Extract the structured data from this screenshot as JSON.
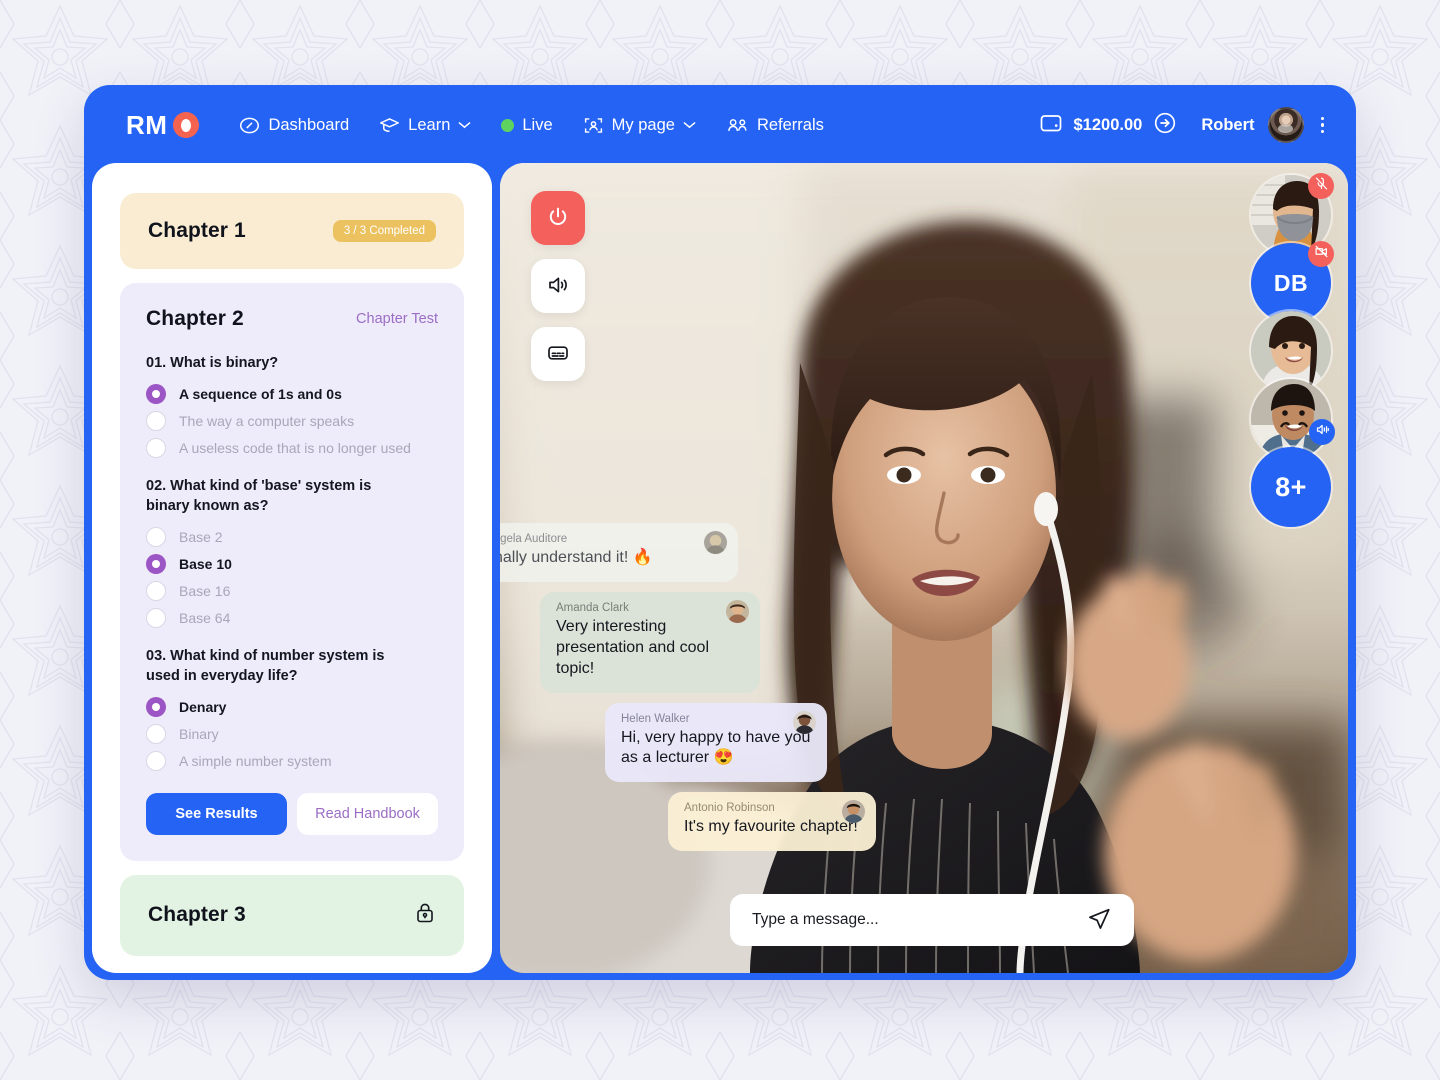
{
  "brand": {
    "text": "RM",
    "dot_icon": "record-dot-icon"
  },
  "nav": [
    {
      "label": "Dashboard",
      "icon": "dashboard-gauge-icon",
      "chevron": false
    },
    {
      "label": "Learn",
      "icon": "graduation-cap-icon",
      "chevron": true
    },
    {
      "label": "Live",
      "icon": "live-dot-icon",
      "chevron": false
    },
    {
      "label": "My page",
      "icon": "user-frame-icon",
      "chevron": true
    },
    {
      "label": "Referrals",
      "icon": "people-group-icon",
      "chevron": false
    }
  ],
  "header_right": {
    "wallet_icon": "wallet-icon",
    "wallet_amount": "$1200.00",
    "wallet_action_icon": "arrow-right-circle-icon",
    "user_name": "Robert",
    "avatar_name": "robert-avatar",
    "menu_icon": "kebab-menu-icon"
  },
  "lesson": {
    "chapter1": {
      "title": "Chapter 1",
      "badge": "3 / 3 Completed"
    },
    "chapter2": {
      "title": "Chapter 2",
      "test_link": "Chapter Test",
      "questions": [
        {
          "text": "01. What is binary?",
          "options": [
            {
              "label": "A sequence of 1s and 0s",
              "selected": true
            },
            {
              "label": "The way a computer speaks",
              "selected": false
            },
            {
              "label": "A useless code that is no longer used",
              "selected": false
            }
          ]
        },
        {
          "text": "02. What kind of 'base' system is binary known as?",
          "options": [
            {
              "label": "Base 2",
              "selected": false
            },
            {
              "label": "Base 10",
              "selected": true
            },
            {
              "label": "Base 16",
              "selected": false
            },
            {
              "label": "Base 64",
              "selected": false
            }
          ]
        },
        {
          "text": "03. What kind of number system is used in everyday life?",
          "options": [
            {
              "label": "Denary",
              "selected": true
            },
            {
              "label": "Binary",
              "selected": false
            },
            {
              "label": "A simple number system",
              "selected": false
            }
          ]
        }
      ],
      "primary_action": "See Results",
      "secondary_action": "Read Handbook"
    },
    "chapter3": {
      "title": "Chapter 3",
      "lock_icon": "lock-icon"
    }
  },
  "call": {
    "controls": [
      {
        "name": "end-call-button",
        "icon": "power-icon"
      },
      {
        "name": "speaker-button",
        "icon": "speaker-icon"
      },
      {
        "name": "captions-button",
        "icon": "captions-icon"
      }
    ],
    "participants": [
      {
        "name": "participant-1",
        "type": "photo",
        "badge": "mic-off-icon",
        "badge_color": "#f4605b"
      },
      {
        "name": "participant-2",
        "type": "initials",
        "label": "DB",
        "badge": "camera-off-icon",
        "badge_color": "#f4605b"
      },
      {
        "name": "participant-3",
        "type": "photo",
        "badge": null
      },
      {
        "name": "participant-4",
        "type": "photo",
        "badge": "speaking-icon",
        "badge_color": "#2563f5"
      },
      {
        "name": "participant-overflow",
        "type": "initials",
        "label": "8+",
        "badge": null
      }
    ],
    "messages": [
      {
        "author": "Angela Auditore",
        "text": "finally understand it! 🔥"
      },
      {
        "author": "Amanda Clark",
        "text": "Very interesting presentation and cool topic!"
      },
      {
        "author": "Helen Walker",
        "text": "Hi, very happy to have you as a lecturer 😍"
      },
      {
        "author": "Antonio Robinson",
        "text": "It's my favourite chapter!"
      }
    ],
    "input": {
      "placeholder": "Type a message...",
      "value": "",
      "send_icon": "send-icon"
    }
  },
  "colors": {
    "brand_blue": "#2563f5",
    "accent_red": "#f4605b",
    "live_green": "#5fd35f",
    "chapter1_bg": "#faecd3",
    "chapter1_badge": "#ecc260",
    "chapter2_bg": "#eeecfb",
    "chapter3_bg": "#e2f3e3",
    "radio_selected": "#9b55c4",
    "link_purple": "#9b6dc4"
  }
}
